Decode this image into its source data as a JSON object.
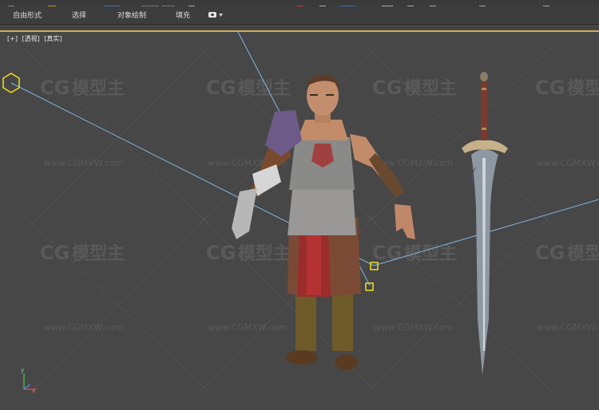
{
  "ribbon": {
    "tabs": [
      "自由形式",
      "选择",
      "对象绘制",
      "填充"
    ]
  },
  "viewport": {
    "label_plus": "[+]",
    "label_view": "[透视]",
    "label_shading": "[真实]"
  },
  "watermark": {
    "logo_text": "模型主",
    "url_text": "www.CGMXW.com"
  },
  "colors": {
    "viewport_bg": "#474747",
    "active_border": "#c9b15b",
    "accent_blue": "#3c6fb8",
    "camera_line": "#7fb6e0"
  },
  "axis": {
    "x": "x",
    "y": "y"
  }
}
